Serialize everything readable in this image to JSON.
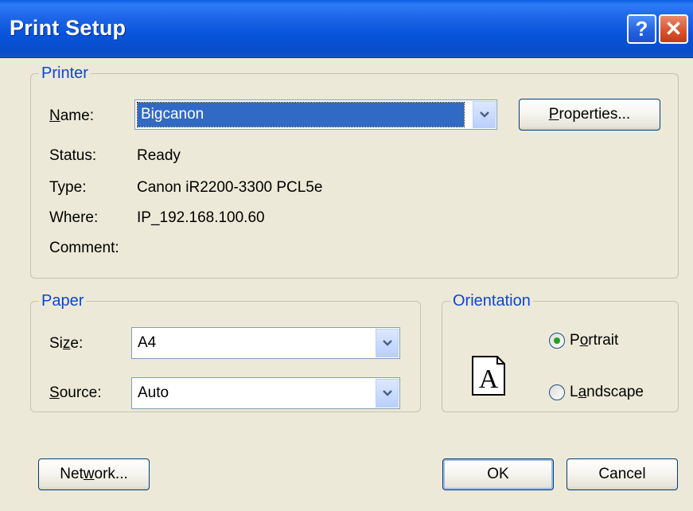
{
  "window": {
    "title": "Print Setup",
    "help_glyph": "?",
    "close_glyph": "✕"
  },
  "printer": {
    "legend": "Printer",
    "name_label": "Name:",
    "name_underline": "N",
    "name_rest": "ame:",
    "name_value": "Bigcanon",
    "properties_underline": "P",
    "properties_rest": "roperties...",
    "status_label": "Status:",
    "status_value": "Ready",
    "type_label": "Type:",
    "type_value": "Canon iR2200-3300 PCL5e",
    "where_label": "Where:",
    "where_value": "IP_192.168.100.60",
    "comment_label": "Comment:",
    "comment_value": ""
  },
  "paper": {
    "legend": "Paper",
    "size_pre": "Si",
    "size_underline": "z",
    "size_post": "e:",
    "size_value": "A4",
    "source_underline": "S",
    "source_rest": "ource:",
    "source_value": "Auto"
  },
  "orientation": {
    "legend": "Orientation",
    "preview_letter": "A",
    "portrait_underline": "o",
    "portrait_pre": "P",
    "portrait_post": "rtrait",
    "landscape_pre": "L",
    "landscape_underline": "a",
    "landscape_post": "ndscape",
    "selected": "portrait"
  },
  "buttons": {
    "network_pre": "Net",
    "network_underline": "w",
    "network_post": "ork...",
    "ok": "OK",
    "cancel": "Cancel"
  },
  "colors": {
    "accent": "#0A46D5",
    "titlebar": "#0754DB",
    "face": "#ECE9D8",
    "selection": "#316AC5"
  }
}
